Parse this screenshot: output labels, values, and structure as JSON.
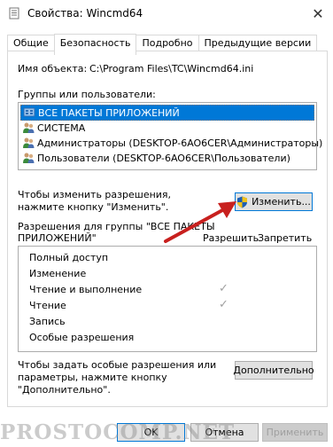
{
  "window": {
    "title": "Свойства: Wincmd64",
    "close_glyph": "✕"
  },
  "tabs": [
    {
      "label": "Общие",
      "active": false
    },
    {
      "label": "Безопасность",
      "active": true
    },
    {
      "label": "Подробно",
      "active": false
    },
    {
      "label": "Предыдущие версии",
      "active": false
    }
  ],
  "security": {
    "object_name_label": "Имя объекта:",
    "object_name_value": "C:\\Program Files\\TC\\Wincmd64.ini",
    "groups_label": "Группы или пользователи:",
    "groups": [
      {
        "name": "ВСЕ ПАКЕТЫ ПРИЛОЖЕНИЙ",
        "icon": "app-packages-icon",
        "selected": true
      },
      {
        "name": "СИСТЕМА",
        "icon": "users-icon",
        "selected": false
      },
      {
        "name": "Администраторы (DESKTOP-6AO6CER\\Администраторы)",
        "icon": "users-icon",
        "selected": false
      },
      {
        "name": "Пользователи (DESKTOP-6AO6CER\\Пользователи)",
        "icon": "users-icon",
        "selected": false
      }
    ],
    "change_hint_line1": "Чтобы изменить разрешения,",
    "change_hint_line2": "нажмите кнопку \"Изменить\".",
    "change_button": "Изменить...",
    "permissions_for_line1": "Разрешения для группы \"ВСЕ ПАКЕТЫ",
    "permissions_for_line2": "ПРИЛОЖЕНИЙ\"",
    "allow_header": "Разрешить",
    "deny_header": "Запретить",
    "permissions": [
      {
        "name": "Полный доступ",
        "allow": false,
        "deny": false
      },
      {
        "name": "Изменение",
        "allow": false,
        "deny": false
      },
      {
        "name": "Чтение и выполнение",
        "allow": true,
        "deny": false
      },
      {
        "name": "Чтение",
        "allow": true,
        "deny": false
      },
      {
        "name": "Запись",
        "allow": false,
        "deny": false
      },
      {
        "name": "Особые разрешения",
        "allow": false,
        "deny": false
      }
    ],
    "check_glyph": "✓",
    "special_hint_line1": "Чтобы задать особые разрешения или",
    "special_hint_line2": "параметры, нажмите кнопку",
    "special_hint_line3": "\"Дополнительно\".",
    "advanced_button": "Дополнительно"
  },
  "footer": {
    "ok": "OK",
    "cancel": "Отмена",
    "apply": "Применить"
  },
  "watermark": "PROSTOCOMP.NET",
  "colors": {
    "selection": "#0078d7",
    "arrow": "#c8201e",
    "shield_blue": "#1e5fb4",
    "shield_yellow": "#f2c21b"
  }
}
